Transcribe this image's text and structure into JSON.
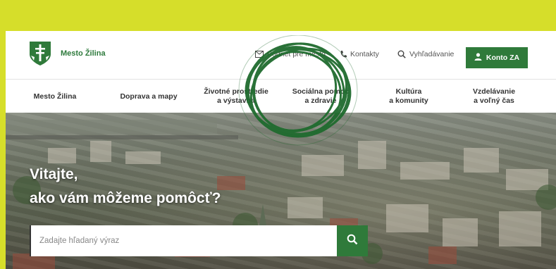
{
  "header": {
    "logo_text": "Mesto Žilina",
    "util": {
      "podnet": "Podnet pre mesto",
      "kontakty": "Kontakty",
      "search": "Vyhľadávanie"
    },
    "konto": "Konto ZA"
  },
  "nav": [
    {
      "label": "Mesto Žilina"
    },
    {
      "label": "Doprava a mapy"
    },
    {
      "label": "Životné prostredie\na výstavba"
    },
    {
      "label": "Sociálna pomoc\na zdravie"
    },
    {
      "label": "Kultúra\na komunity"
    },
    {
      "label": "Vzdelávanie\na voľný čas"
    }
  ],
  "hero": {
    "title_line1": "Vitajte,",
    "title_line2": "ako vám môžeme pomôcť?",
    "search_placeholder": "Zadajte hľadaný výraz"
  },
  "colors": {
    "brand_green": "#2f7a3a",
    "background_yellow": "#d6de2a",
    "scribble": "#1f6b2e"
  },
  "icons": [
    "mail-icon",
    "phone-icon",
    "search-icon",
    "user-icon"
  ]
}
